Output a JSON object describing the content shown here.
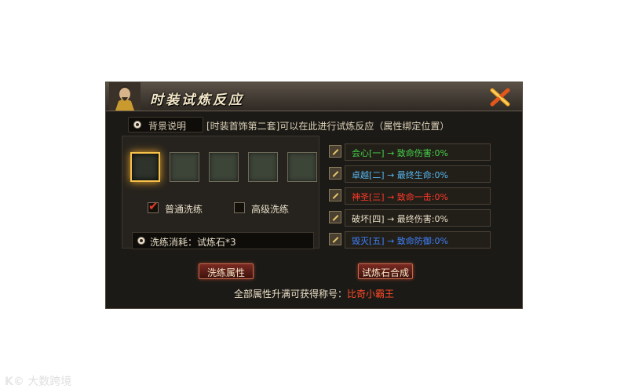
{
  "title": "时装试炼反应",
  "tab": {
    "label": "背景说明"
  },
  "description": "[时装首饰第二套]可以在此进行试炼反应（属性绑定位置）",
  "slots_count": 5,
  "options": [
    {
      "label": "普通洗练",
      "checked": true
    },
    {
      "label": "高级洗练",
      "checked": false
    }
  ],
  "cost_text": "洗练消耗：试炼石*3",
  "attributes": [
    {
      "text": "会心[一] → 致命伤害:0%",
      "color": "#45d14a"
    },
    {
      "text": "卓越[二] → 最终生命:0%",
      "color": "#57b8f0"
    },
    {
      "text": "神圣[三] → 致命一击:0%",
      "color": "#ff3a2a"
    },
    {
      "text": "破坏[四] → 最终伤害:0%",
      "color": "#e9dfc7"
    },
    {
      "text": "毁灭[五] → 致命防御:0%",
      "color": "#3f84ff"
    }
  ],
  "buttons": {
    "wash": "洗练属性",
    "synth": "试炼石合成"
  },
  "footer": {
    "text": "全部属性升满可获得称号：",
    "title_name": "比奇小霸王"
  },
  "watermark": "大数跨境"
}
